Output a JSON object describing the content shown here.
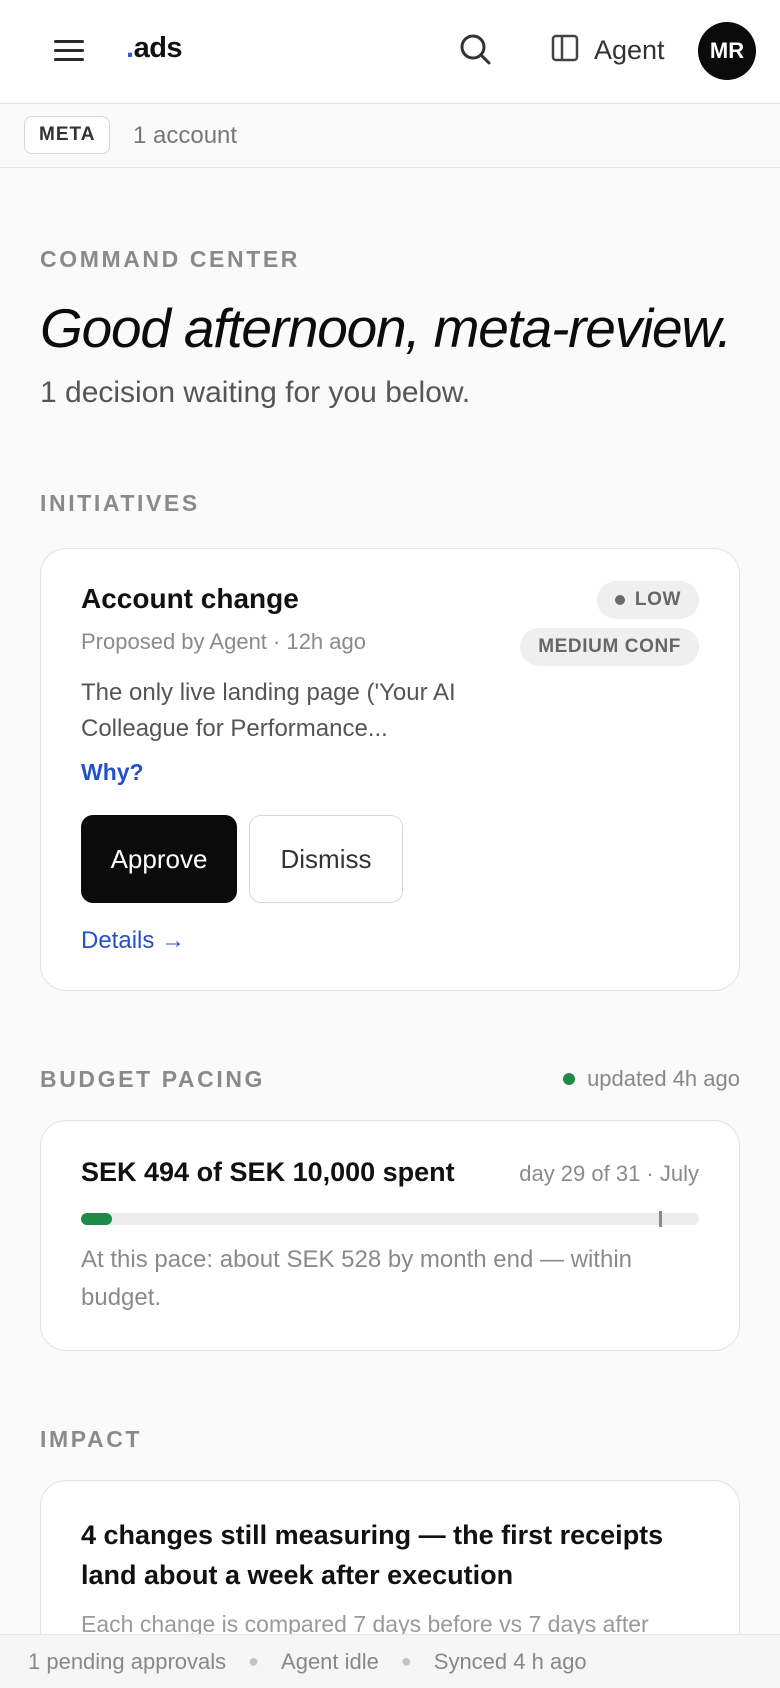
{
  "header": {
    "logo_dot": ".",
    "logo_text": "ads",
    "agent_label": "Agent",
    "avatar_initials": "MR"
  },
  "platform": {
    "badge": "META",
    "accounts": "1 account"
  },
  "hero": {
    "eyebrow": "COMMAND CENTER",
    "title": "Good afternoon, meta-review.",
    "subtitle": "1 decision waiting for you below."
  },
  "initiatives": {
    "section_label": "INITIATIVES",
    "card": {
      "title": "Account change",
      "meta": "Proposed by Agent · 12h ago",
      "severity": "LOW",
      "confidence": "MEDIUM CONF",
      "description": "The only live landing page ('Your AI Colleague for Performance...",
      "why_label": "Why?",
      "approve_label": "Approve",
      "dismiss_label": "Dismiss",
      "details_label": "Details →"
    }
  },
  "budget": {
    "section_label": "BUDGET PACING",
    "updated": "updated 4h ago",
    "spend_text": "SEK 494 of SEK 10,000 spent",
    "day_info": "day 29 of 31 · July",
    "spent_fraction": 0.0494,
    "elapsed_fraction": 0.935,
    "pace_text": "At this pace: about SEK 528 by month end — within budget.",
    "colors": {
      "fill": "#1f8a48",
      "track": "#ececec"
    }
  },
  "impact": {
    "section_label": "IMPACT",
    "title": "4 changes still measuring — the first receipts land about a week after execution",
    "subtitle": "Each change is compared 7 days before vs 7 days after"
  },
  "statusbar": {
    "pending": "1 pending approvals",
    "agent": "Agent idle",
    "synced": "Synced 4 h ago"
  },
  "colors": {
    "accent_link": "#2650c8",
    "primary_button": "#0b0b0b",
    "status_green": "#1f8a48"
  }
}
